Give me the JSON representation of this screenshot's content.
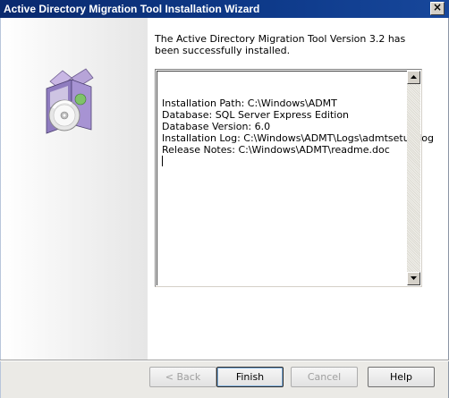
{
  "window": {
    "title": "Active Directory Migration Tool Installation Wizard",
    "close_glyph": "×"
  },
  "icon": {
    "name": "software-install-box-icon"
  },
  "main": {
    "message": "The Active Directory Migration Tool Version 3.2 has been successfully installed.",
    "details": [
      "Installation Path: C:\\Windows\\ADMT",
      "Database: SQL Server Express Edition",
      "Database Version: 6.0",
      "Installation Log: C:\\Windows\\ADMT\\Logs\\admtsetup.log",
      "Release Notes: C:\\Windows\\ADMT\\readme.doc"
    ]
  },
  "buttons": {
    "back": "< Back",
    "finish": "Finish",
    "cancel": "Cancel",
    "help": "Help"
  },
  "colors": {
    "titlebar": "#0e3a8a",
    "disabled_text": "#a0a0a0"
  }
}
